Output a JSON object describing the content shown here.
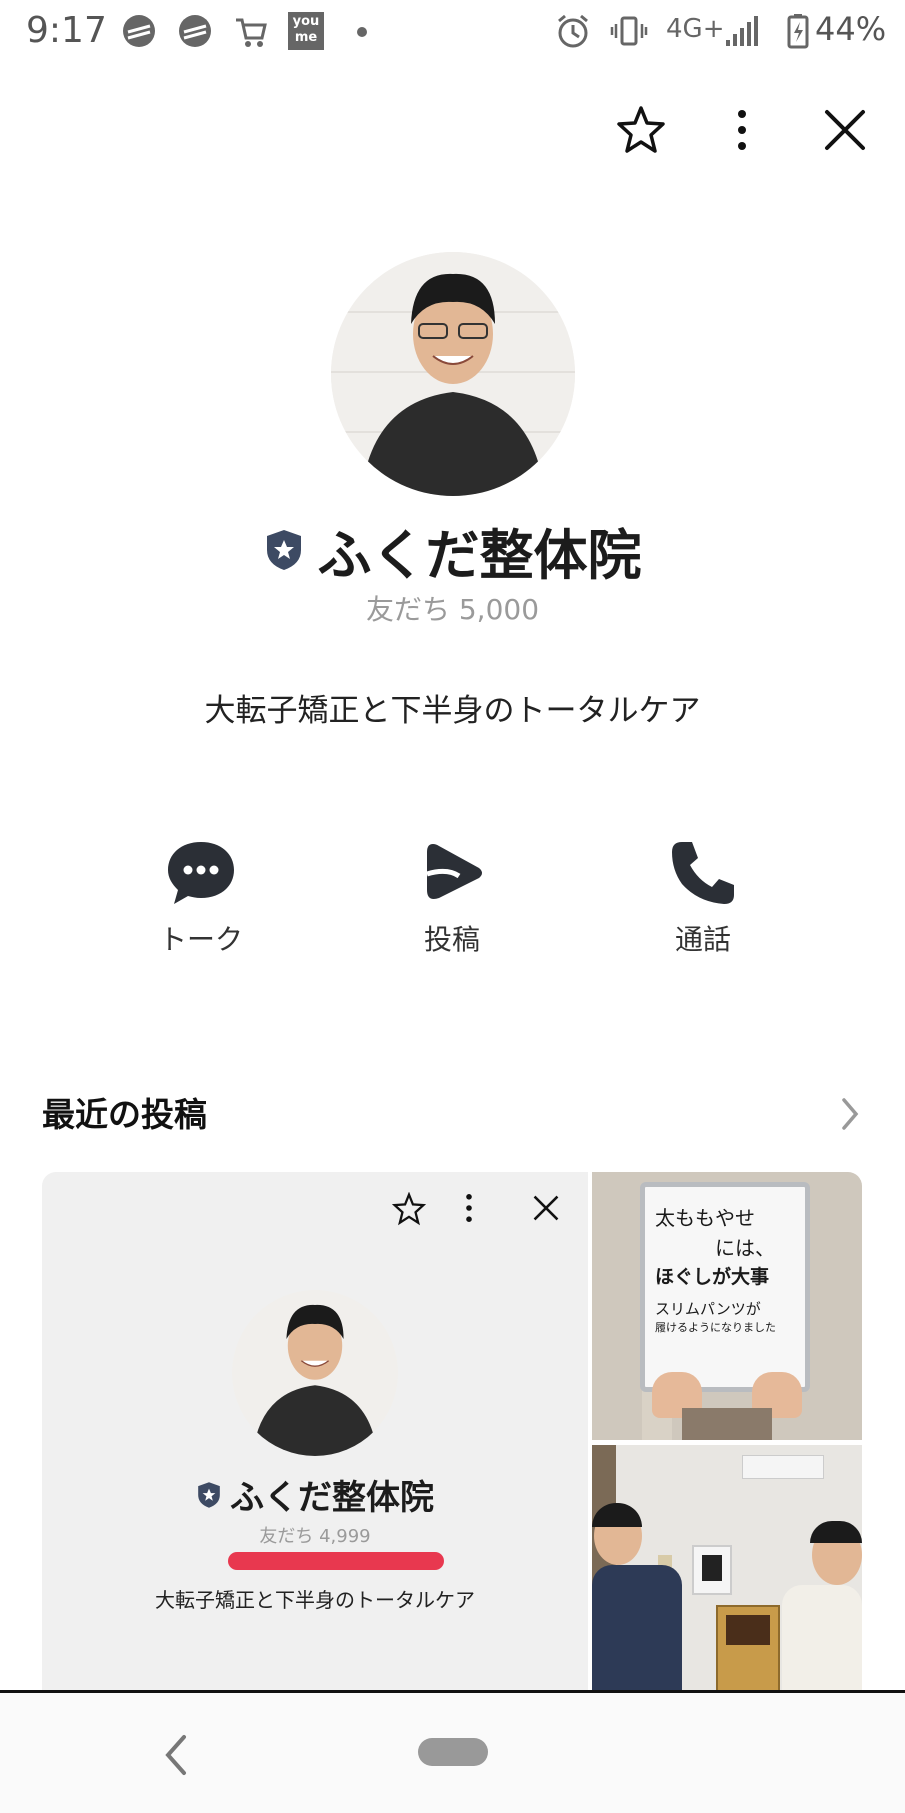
{
  "status_bar": {
    "time": "9:17",
    "battery": "44%",
    "network": "4G+",
    "icons": [
      "app-icon",
      "app-icon",
      "cart-icon",
      "youme-icon",
      "dot-icon",
      "alarm-icon",
      "vibrate-icon",
      "signal-icon",
      "battery-icon"
    ],
    "youme_label": "you me"
  },
  "header": {
    "icons": [
      "star-icon",
      "more-vertical-icon",
      "close-icon"
    ]
  },
  "profile": {
    "name": "ふくだ整体院",
    "friends": "友だち 5,000",
    "description": "大転子矯正と下半身のトータルケア"
  },
  "actions": [
    {
      "label": "トーク",
      "icon": "chat-icon"
    },
    {
      "label": "投稿",
      "icon": "post-icon"
    },
    {
      "label": "通話",
      "icon": "phone-icon"
    }
  ],
  "recent": {
    "title": "最近の投稿",
    "inner_name": "ふくだ整体院",
    "inner_friends": "友だち 4,999",
    "inner_desc": "大転子矯正と下半身のトータルケア",
    "whiteboard": [
      "太ももやせ",
      "には、",
      "ほぐしが大事",
      "スリムパンツが",
      "履けるようになりました"
    ]
  },
  "colors": {
    "accent_red": "#e8384f",
    "badge": "#3d4a63",
    "icon_dark": "#2b2f36"
  }
}
